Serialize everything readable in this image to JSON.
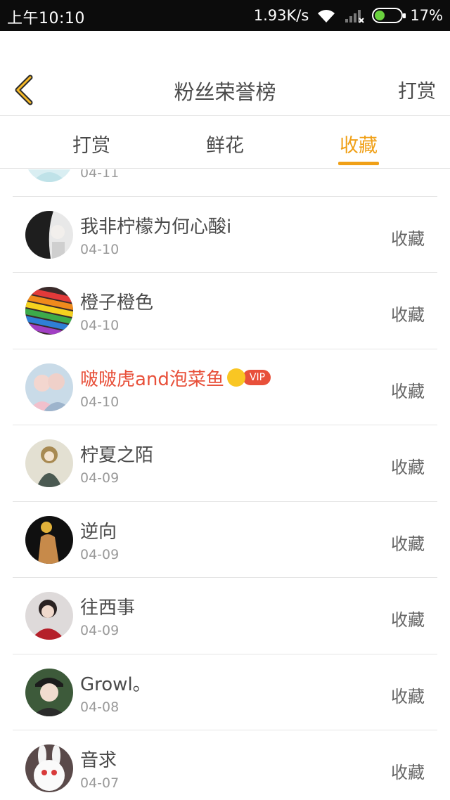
{
  "status_bar": {
    "time": "上午10:10",
    "net_speed": "1.93K/s",
    "battery_pct": "17%",
    "battery_level": 0.17,
    "icons": [
      "wifi-icon",
      "signal-icon",
      "battery-icon"
    ]
  },
  "header": {
    "title": "粉丝荣誉榜",
    "action": "打赏"
  },
  "tabs": {
    "items": [
      {
        "label": "打赏"
      },
      {
        "label": "鲜花"
      },
      {
        "label": "收藏"
      }
    ],
    "active_index": 2
  },
  "colors": {
    "accent": "#f0a017",
    "vip_name": "#e8503a",
    "text_primary": "#4a4a4a",
    "text_secondary": "#9a9a9a"
  },
  "list": {
    "items": [
      {
        "name": "",
        "date": "04-11",
        "action": "",
        "avatar": "avatar-partial"
      },
      {
        "name": "我非柠檬为何心酸i",
        "date": "04-10",
        "action": "收藏",
        "avatar": "avatar-dark-girl"
      },
      {
        "name": "橙子橙色",
        "date": "04-10",
        "action": "收藏",
        "avatar": "avatar-pencils"
      },
      {
        "name": "啵啵虎and泡菜鱼",
        "date": "04-10",
        "action": "收藏",
        "vip": true,
        "vip_badge": "VIP",
        "avatar": "avatar-couple"
      },
      {
        "name": "柠夏之陌",
        "date": "04-09",
        "action": "收藏",
        "avatar": "avatar-anime-girl"
      },
      {
        "name": "逆向",
        "date": "04-09",
        "action": "收藏",
        "avatar": "avatar-figure"
      },
      {
        "name": "往西事",
        "date": "04-09",
        "action": "收藏",
        "avatar": "avatar-boy-red"
      },
      {
        "name": "Growl。",
        "date": "04-08",
        "action": "收藏",
        "avatar": "avatar-boy-cap"
      },
      {
        "name": "音求",
        "date": "04-07",
        "action": "收藏",
        "avatar": "avatar-bunny"
      }
    ]
  }
}
